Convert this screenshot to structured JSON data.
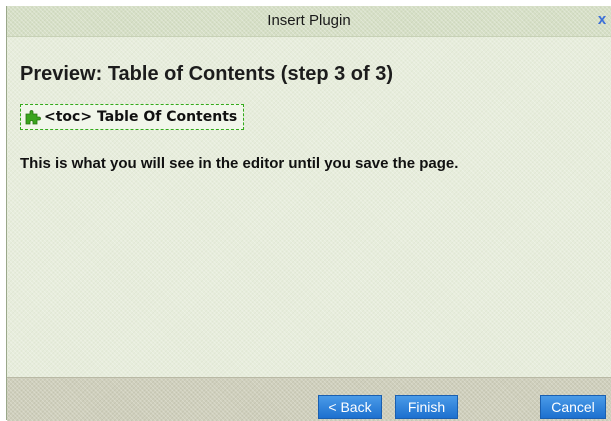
{
  "dialog": {
    "title": "Insert Plugin",
    "close_glyph": "x",
    "close_icon": "close-icon",
    "heading": "Preview: Table of Contents (step 3 of 3)",
    "plugin_tag": {
      "icon": "puzzle-piece-icon",
      "icon_color": "#3aa51e",
      "label": "<toc> Table Of Contents"
    },
    "info": "This is what you will see in the editor until you save the page."
  },
  "footer": {
    "back_label": "< Back",
    "finish_label": "Finish",
    "cancel_label": "Cancel"
  },
  "colors": {
    "accent_button": "#2f86dc",
    "close_icon": "#3b6fd8",
    "dashed_border": "#33aa1a"
  }
}
